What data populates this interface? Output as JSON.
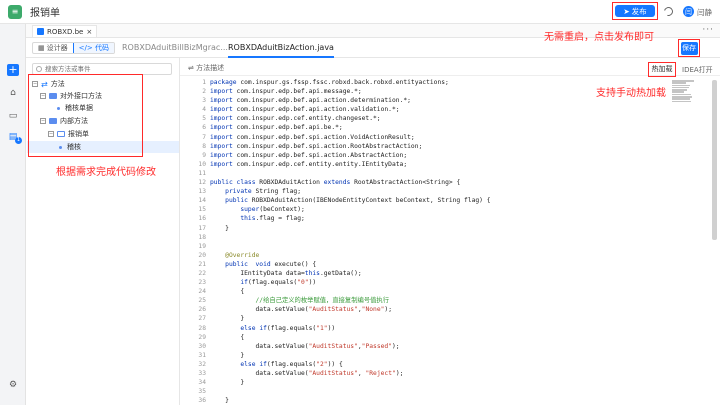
{
  "app": {
    "title": "报销单",
    "logo_glyph": "≡"
  },
  "topbar": {
    "publish_label": "发布",
    "user_name": "闫静",
    "avatar_initial": "闫"
  },
  "file_tab": {
    "label": "ROBXD.be",
    "more": "···"
  },
  "subbar": {
    "design_label": "设计器",
    "code_label": "</> 代码",
    "tabs": [
      {
        "label": "ROBXDAduitBillBizMgrac..."
      },
      {
        "label": "ROBXDAduitBizAction.java"
      }
    ],
    "save_label": "保存"
  },
  "explorer": {
    "search_placeholder": "搜索方法或事件",
    "tree": [
      {
        "label": "方法",
        "twisty": "−"
      },
      {
        "label": "对外接口方法",
        "twisty": "−"
      },
      {
        "label": "稽核单据"
      },
      {
        "label": "内部方法",
        "twisty": "−"
      },
      {
        "label": "报销单",
        "twisty": "−"
      },
      {
        "label": "稽核"
      }
    ]
  },
  "editor": {
    "outline_label": "方法描述",
    "hot_reload_label": "热加载",
    "idea_label": "IDEA打开",
    "start_line": 1,
    "lines": [
      "package com.inspur.gs.fssp.fssc.robxd.back.robxd.entityactions;",
      "import com.inspur.edp.bef.api.message.*;",
      "import com.inspur.edp.bef.api.action.determination.*;",
      "import com.inspur.edp.bef.api.action.validation.*;",
      "import com.inspur.edp.cef.entity.changeset.*;",
      "import com.inspur.edp.bef.api.be.*;",
      "import com.inspur.edp.bef.spi.action.VoidActionResult;",
      "import com.inspur.edp.bef.spi.action.RootAbstractAction;",
      "import com.inspur.edp.bef.spi.action.AbstractAction;",
      "import com.inspur.edp.cef.entity.entity.IEntityData;",
      "",
      "public class ROBXDAduitAction extends RootAbstractAction<String> {",
      "    private String flag;",
      "    public ROBXDAduitAction(IBENodeEntityContext beContext, String flag) {",
      "        super(beContext);",
      "        this.flag = flag;",
      "    }",
      "",
      "",
      "    @Override",
      "    public  void execute() {",
      "        IEntityData data=this.getData();",
      "        if(flag.equals(\"0\"))",
      "        {",
      "            //给自己定义的枚举赋值，直接复制编号值执行",
      "            data.setValue(\"AuditStatus\",\"None\");",
      "        }",
      "        else if(flag.equals(\"1\"))",
      "        {",
      "            data.setValue(\"AuditStatus\",\"Passed\");",
      "        }",
      "        else if(flag.equals(\"2\")) {",
      "            data.setValue(\"AuditStatus\", \"Reject\");",
      "        }",
      "",
      "    }"
    ]
  },
  "annotations": {
    "publish_note": "无需重启，点击发布即可",
    "hot_reload_note": "支持手动热加载",
    "code_note": "根据需求完成代码修改"
  },
  "colors": {
    "accent": "#1677ff",
    "annotation": "#ff2a2a"
  }
}
